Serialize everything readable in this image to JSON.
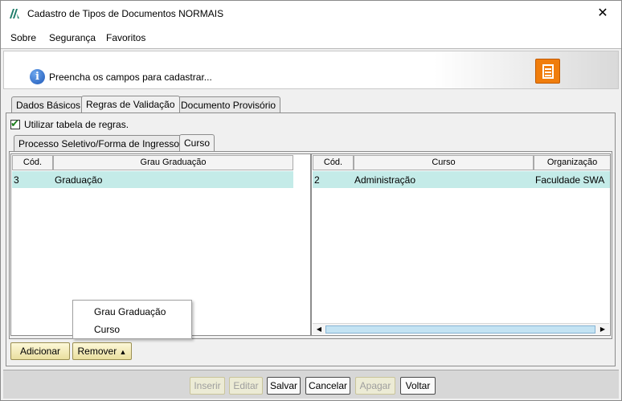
{
  "window": {
    "title": "Cadastro de Tipos de Documentos NORMAIS",
    "close_icon": "✕"
  },
  "menu": [
    {
      "label": "Sobre"
    },
    {
      "label": "Segurança"
    },
    {
      "label": "Favoritos"
    }
  ],
  "info": {
    "icon": "i",
    "message": "Preencha os campos para cadastrar..."
  },
  "tabs": [
    {
      "label": "Dados Básicos"
    },
    {
      "label": "Regras de Validação"
    },
    {
      "label": "Documento Provisório"
    }
  ],
  "rules_checkbox": {
    "label": "Utilizar tabela de regras.",
    "checked": true,
    "check_glyph": "✔"
  },
  "subtabs": [
    {
      "label": "Processo Seletivo/Forma de Ingresso"
    },
    {
      "label": "Curso"
    }
  ],
  "left_grid": {
    "headers": [
      "Cód.",
      "Grau Graduação"
    ],
    "rows": [
      {
        "cod": "3",
        "grau": "Graduação"
      }
    ]
  },
  "right_grid": {
    "headers": [
      "Cód.",
      "Curso",
      "Organização"
    ],
    "rows": [
      {
        "cod": "2",
        "curso": "Administração",
        "org": "Faculdade SWA"
      }
    ],
    "scroll_left_icon": "◀",
    "scroll_right_icon": "▶"
  },
  "popup_menu": {
    "items": [
      {
        "label": "Grau Graduação"
      },
      {
        "label": "Curso"
      }
    ]
  },
  "actions": {
    "adicionar": "Adicionar",
    "remover": "Remover",
    "remover_arrow": "▲"
  },
  "footer": {
    "inserir": "Inserir",
    "editar": "Editar",
    "salvar": "Salvar",
    "cancelar": "Cancelar",
    "apagar": "Apagar",
    "voltar": "Voltar"
  }
}
